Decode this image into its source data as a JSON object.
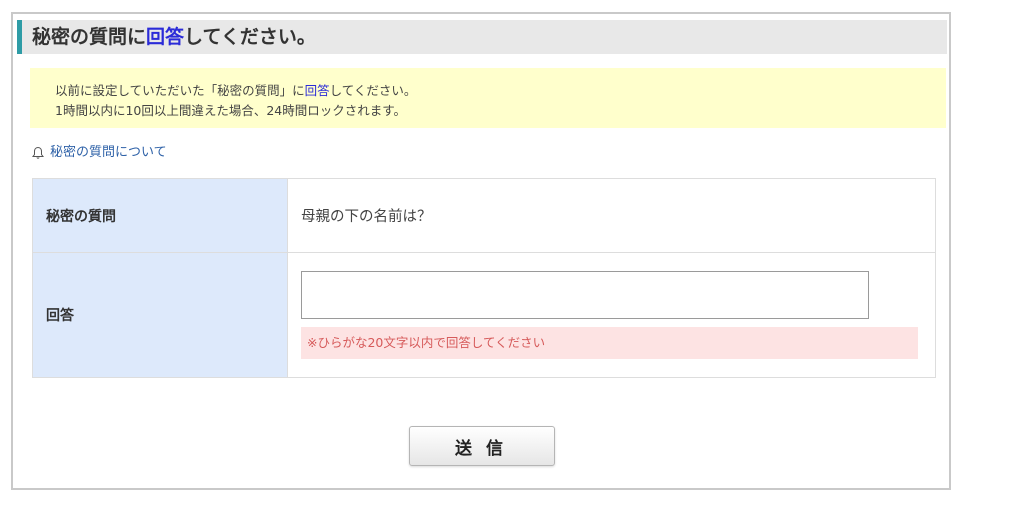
{
  "page": {
    "title": {
      "before": "秘密の質問に",
      "emphasis": "回答",
      "after": "してください。"
    },
    "notice": {
      "line1_before": "以前に設定していただいた「秘密の質問」に",
      "line1_emphasis": "回答",
      "line1_after": "してください。",
      "line2": "1時間以内に10回以上間違えた場合、24時間ロックされます。"
    },
    "about_link": "秘密の質問について",
    "about_link_icon": "bell-icon",
    "question": {
      "label": "秘密の質問",
      "value": "母親の下の名前は？"
    },
    "answer": {
      "label": "回答",
      "value": "",
      "placeholder": "",
      "hint": "※ひらがな20文字以内で回答してください"
    },
    "submit_label": "送信",
    "colors": {
      "accent_bar": "#2e9ca6",
      "emphasis_text": "#2b2bd8",
      "notice_bg": "#ffffcc",
      "label_bg": "#dde9fb",
      "hint_bg": "#fde3e3",
      "hint_text": "#d65a5a",
      "link": "#2f62a8"
    }
  }
}
